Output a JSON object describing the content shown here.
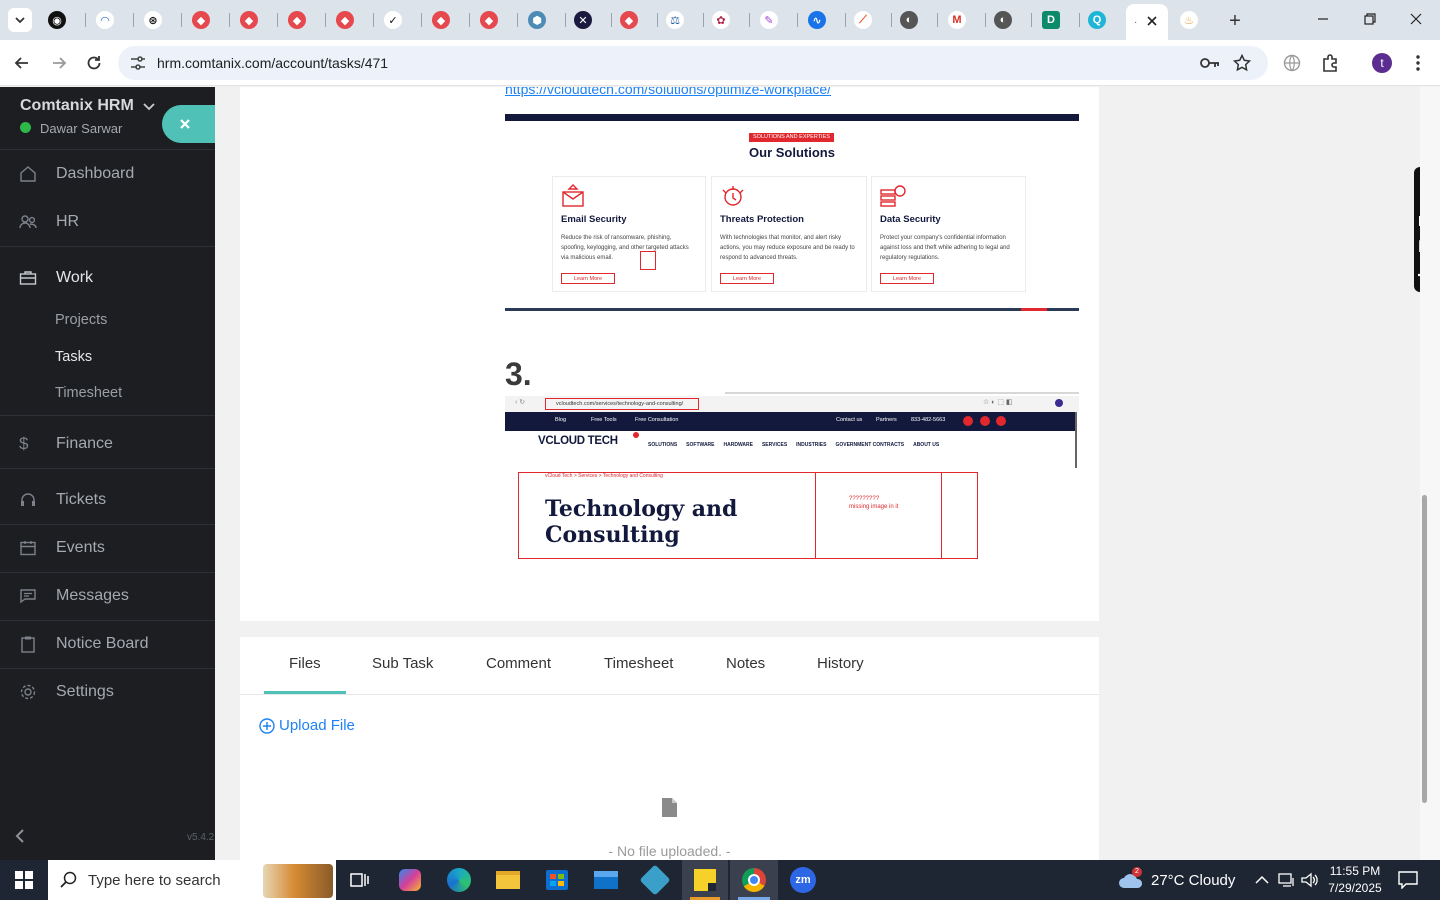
{
  "browser": {
    "url": "hrm.comtanix.com/account/tasks/471",
    "profile_initial": "t"
  },
  "sidebar": {
    "brand": "Comtanix HRM",
    "user": "Dawar Sarwar",
    "nav": [
      {
        "label": "Dashboard",
        "icon": "home-icon"
      },
      {
        "label": "HR",
        "icon": "users-icon"
      },
      {
        "label": "Work",
        "icon": "briefcase-icon"
      },
      {
        "label": "Finance",
        "icon": "dollar-icon"
      },
      {
        "label": "Tickets",
        "icon": "headset-icon"
      },
      {
        "label": "Events",
        "icon": "calendar-icon"
      },
      {
        "label": "Messages",
        "icon": "message-icon"
      },
      {
        "label": "Notice Board",
        "icon": "clipboard-icon"
      },
      {
        "label": "Settings",
        "icon": "gear-icon"
      }
    ],
    "work_sub": [
      "Projects",
      "Tasks",
      "Timesheet"
    ],
    "version": "v5.4.2"
  },
  "task_body": {
    "link": "https://vcloudtech.com/solutions/optimize-workplace/",
    "solutions_badge": "SOLUTIONS AND EXPERTIES",
    "solutions_title": "Our Solutions",
    "solutions": [
      {
        "title": "Email Security",
        "text": "Reduce the risk of ransomware, phishing, spoofing, keylogging, and other targeted attacks via malicious email.",
        "cta": "Learn More"
      },
      {
        "title": "Threats Protection",
        "text": "With technologies that monitor, and alert risky actions, you may reduce exposure and be ready to respond to advanced threats.",
        "cta": "Learn More"
      },
      {
        "title": "Data Security",
        "text": "Protect your company's confidential information against loss and theft while adhering to legal and regulatory regulations.",
        "cta": "Learn More"
      }
    ],
    "step_number": "3.",
    "shot": {
      "url": "vcloudtech.com/services/technology-and-consulting/",
      "topbar_left": [
        "Blog",
        "Free Tools",
        "Free Consultation"
      ],
      "topbar_right": [
        "Contact us",
        "Partners",
        "833-482-5663"
      ],
      "logo": "VCLOUD TECH",
      "menu": [
        "SOLUTIONS",
        "SOFTWARE",
        "HARDWARE",
        "SERVICES",
        "INDUSTRIES",
        "GOVERNMENT CONTRACTS",
        "ABOUT US"
      ],
      "breadcrumb": "vCloud Tech  >  Services  >  Technology and Consulting",
      "heading_line1": "Technology and",
      "heading_line2": "Consulting",
      "annotation_line1": "?????????",
      "annotation_line2": "missing image in it"
    }
  },
  "tabs": [
    "Files",
    "Sub Task",
    "Comment",
    "Timesheet",
    "Notes",
    "History"
  ],
  "files": {
    "upload_label": "Upload File",
    "empty_text": "- No file uploaded. -"
  },
  "taskbar": {
    "search_placeholder": "Type here to search",
    "weather": "27°C  Cloudy",
    "weather_badge": "2",
    "time": "11:55 PM",
    "date": "7/29/2025"
  },
  "colors": {
    "sidebar_bg": "#1c1e22",
    "accent_teal": "#4fc1b7",
    "link_blue": "#1d82f5",
    "annotation_red": "#e0282e",
    "vcloud_navy": "#12193d"
  }
}
